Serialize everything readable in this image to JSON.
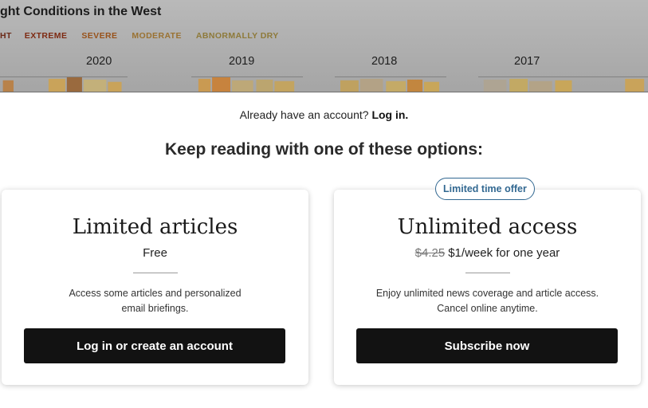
{
  "background_article": {
    "title": "ght Conditions in the West",
    "legend": [
      {
        "label": "HT",
        "color": "#7a2a1a"
      },
      {
        "label": "EXTREME",
        "color": "#8b2b12"
      },
      {
        "label": "SEVERE",
        "color": "#a35412"
      },
      {
        "label": "MODERATE",
        "color": "#a8772c"
      },
      {
        "label": "ABNORMALLY DRY",
        "color": "#9a8440"
      }
    ],
    "years": [
      "2020",
      "2019",
      "2018",
      "2017"
    ]
  },
  "paywall": {
    "login_prompt": "Already have an account?",
    "login_link": "Log in.",
    "headline": "Keep reading with one of these options:",
    "offer_badge": "Limited time offer",
    "options": [
      {
        "title": "Limited articles",
        "price": "Free",
        "description_line1": "Access some articles and personalized",
        "description_line2": "email briefings.",
        "button": "Log in or create an account"
      },
      {
        "title": "Unlimited access",
        "price_old": "$4.25",
        "price_new": "$1/week for one year",
        "description_line1": "Enjoy unlimited news coverage and article access.",
        "description_line2": "Cancel online anytime.",
        "button": "Subscribe now"
      }
    ]
  }
}
